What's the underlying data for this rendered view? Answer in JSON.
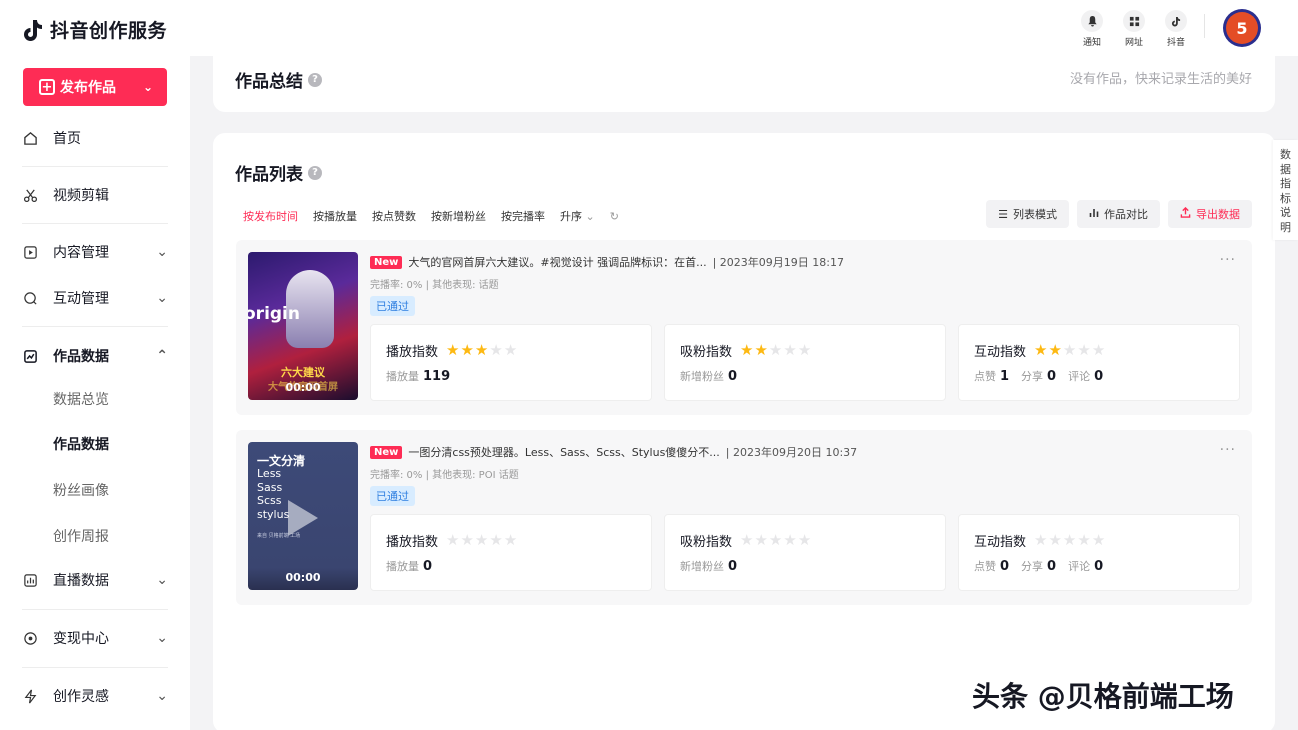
{
  "app": {
    "title": "抖音创作服务"
  },
  "sidebar": {
    "publish_label": "发布作品",
    "items": [
      {
        "label": "首页"
      },
      {
        "label": "视频剪辑"
      },
      {
        "label": "内容管理"
      },
      {
        "label": "互动管理"
      },
      {
        "label": "作品数据"
      },
      {
        "label": "直播数据"
      },
      {
        "label": "变现中心"
      },
      {
        "label": "创作灵感"
      }
    ],
    "sub_items": [
      {
        "label": "数据总览"
      },
      {
        "label": "作品数据"
      },
      {
        "label": "粉丝画像"
      },
      {
        "label": "创作周报"
      }
    ]
  },
  "topbar": {
    "notify_label": "通知",
    "site_label": "网址",
    "douyin_label": "抖音",
    "avatar_text": "5"
  },
  "summary": {
    "title": "作品总结",
    "empty_tip": "没有作品，快来记录生活的美好"
  },
  "list": {
    "title": "作品列表",
    "sort": [
      "按发布时间",
      "按播放量",
      "按点赞数",
      "按新增粉丝",
      "按完播率",
      "升序"
    ],
    "tools": {
      "list_mode": "列表模式",
      "compare": "作品对比",
      "export": "导出数据"
    },
    "videos": [
      {
        "badge": "New",
        "title": "大气的官网首屏六大建议。#视觉设计 强调品牌标识：在首...",
        "date": "| 2023年09月19日 18:17",
        "sub": "完播率: 0% | 其他表现: 话题",
        "status": "已通过",
        "duration": "00:00",
        "thumb_big": "origin",
        "thumb_cap1": "六大建议",
        "thumb_cap2": "大气的官网首屏",
        "play": {
          "name": "播放指数",
          "stars": 3,
          "label": "播放量",
          "value": "119"
        },
        "fans": {
          "name": "吸粉指数",
          "stars": 2,
          "label": "新增粉丝",
          "value": "0"
        },
        "inter": {
          "name": "互动指数",
          "stars": 2,
          "like_label": "点赞",
          "like": "1",
          "share_label": "分享",
          "share": "0",
          "comment_label": "评论",
          "comment": "0"
        }
      },
      {
        "badge": "New",
        "title": "一图分清css预处理器。Less、Sass、Scss、Stylus傻傻分不...",
        "date": "| 2023年09月20日 10:37",
        "sub": "完播率: 0% | 其他表现: POI 话题",
        "status": "已通过",
        "duration": "00:00",
        "thumb_head": "一文分清",
        "thumb_lines": [
          "Less",
          "Sass",
          "Scss",
          "stylus"
        ],
        "thumb_foot": "来自 贝格前端 工场",
        "play": {
          "name": "播放指数",
          "stars": 0,
          "label": "播放量",
          "value": "0"
        },
        "fans": {
          "name": "吸粉指数",
          "stars": 0,
          "label": "新增粉丝",
          "value": "0"
        },
        "inter": {
          "name": "互动指数",
          "stars": 0,
          "like_label": "点赞",
          "like": "0",
          "share_label": "分享",
          "share": "0",
          "comment_label": "评论",
          "comment": "0"
        }
      }
    ]
  },
  "side_tab": "数据指标说明",
  "watermark": "头条 @贝格前端工场",
  "colors": {
    "accent": "#fe2c55",
    "star": "#fdb913",
    "passed_bg": "#d8ecff"
  }
}
